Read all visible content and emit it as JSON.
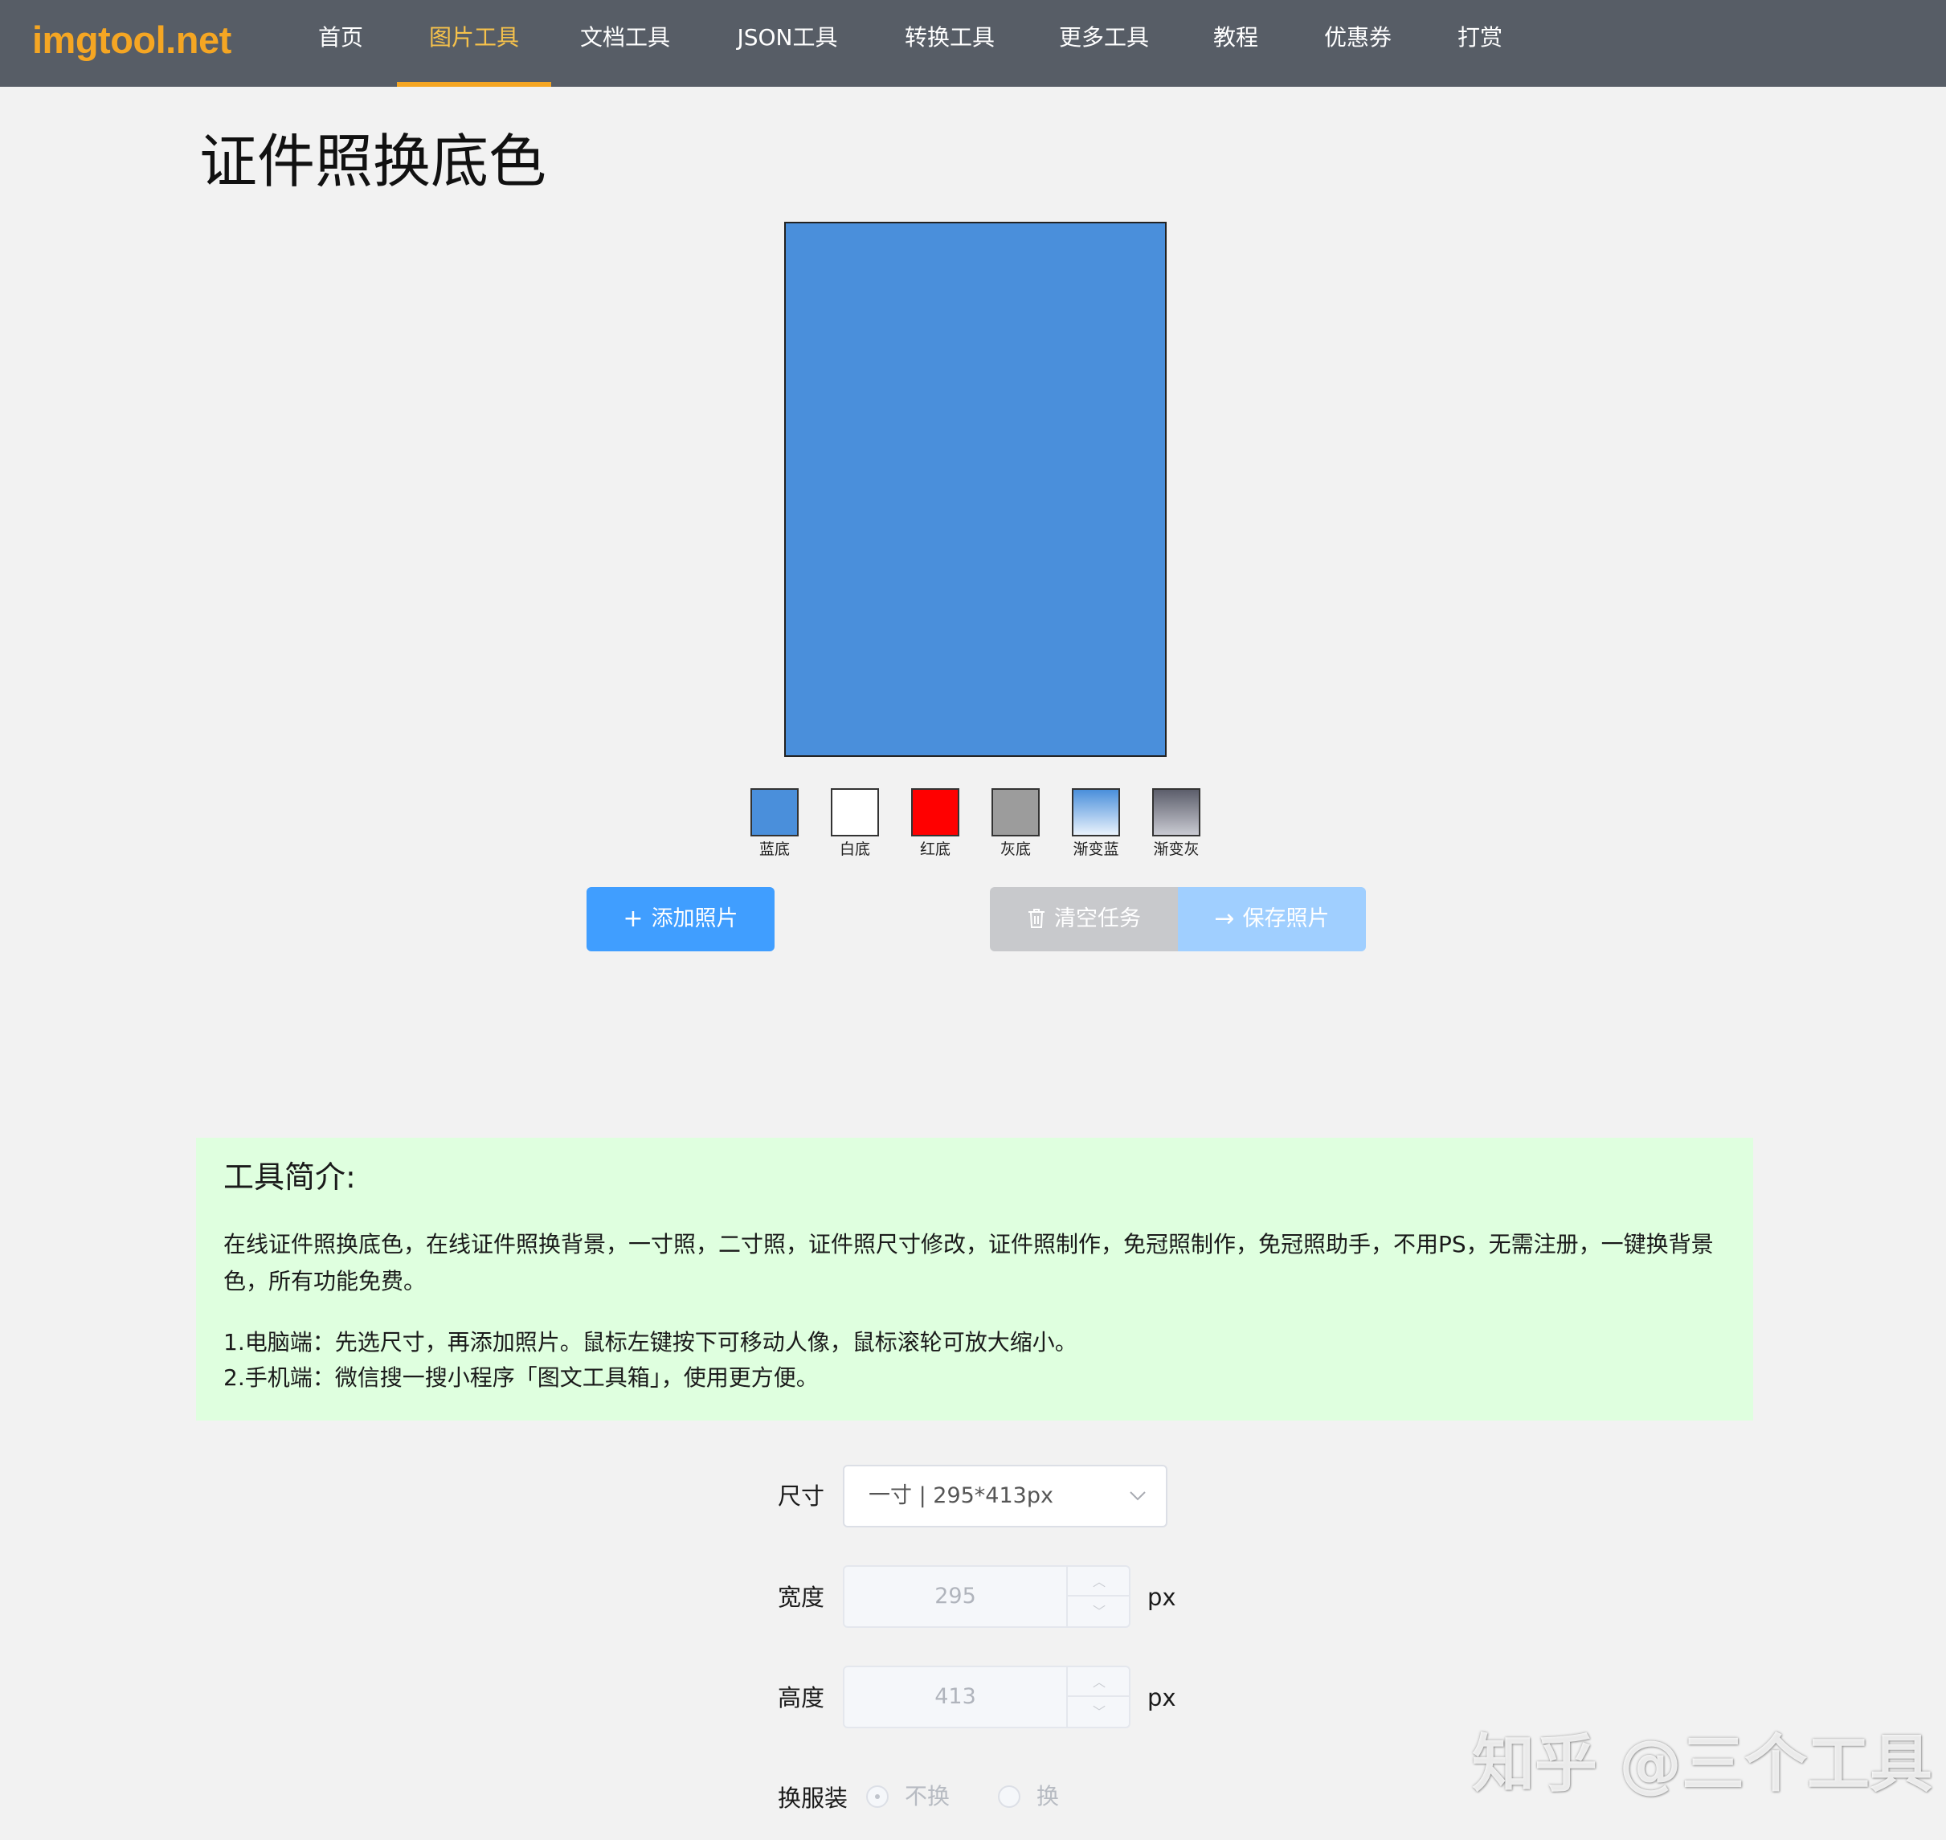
{
  "nav": {
    "logo": "imgtool.net",
    "items": [
      {
        "label": "首页"
      },
      {
        "label": "图片工具",
        "active": true
      },
      {
        "label": "文档工具"
      },
      {
        "label": "JSON工具"
      },
      {
        "label": "转换工具"
      },
      {
        "label": "更多工具"
      },
      {
        "label": "教程"
      },
      {
        "label": "优惠券"
      },
      {
        "label": "打赏"
      }
    ],
    "text_color": "#ffffff",
    "active_color": "#f7c24b",
    "bg_color": "#575d66"
  },
  "page": {
    "title": "证件照换底色"
  },
  "preview": {
    "bg_color": "#4a8fdb"
  },
  "swatches": [
    {
      "label": "蓝底",
      "color": "#4a8fdb"
    },
    {
      "label": "白底",
      "color": "#ffffff"
    },
    {
      "label": "红底",
      "color": "#ff0000"
    },
    {
      "label": "灰底",
      "color": "#9c9c9c"
    },
    {
      "label": "渐变蓝",
      "color": "linear-gradient(#4a8fdb,#e9f2fc)"
    },
    {
      "label": "渐变灰",
      "color": "linear-gradient(#5c5e6b,#c9cad2)"
    }
  ],
  "actions": {
    "add_label": "添加照片",
    "clear_label": "清空任务",
    "save_label": "保存照片",
    "add_icon": "plus-icon",
    "clear_icon": "trash-icon",
    "save_icon": "arrow-right-icon"
  },
  "intro": {
    "title": "工具简介:",
    "p1": "在线证件照换底色，在线证件照换背景，一寸照，二寸照，证件照尺寸修改，证件照制作，免冠照制作，免冠照助手，不用PS，无需注册，一键换背景色，所有功能免费。",
    "p2": "1.电脑端：先选尺寸，再添加照片。鼠标左键按下可移动人像，鼠标滚轮可放大缩小。",
    "p3": "2.手机端：微信搜一搜小程序「图文工具箱」，使用更方便。"
  },
  "form": {
    "size_label": "尺寸",
    "size_value": "一寸 | 295*413px",
    "width_label": "宽度",
    "width_value": "295",
    "height_label": "高度",
    "height_value": "413",
    "unit": "px",
    "outfit_label": "换服装",
    "outfit_options": [
      "不换",
      "换"
    ],
    "outfit_selected": "不换"
  },
  "watermark": "知乎 @三个工具"
}
